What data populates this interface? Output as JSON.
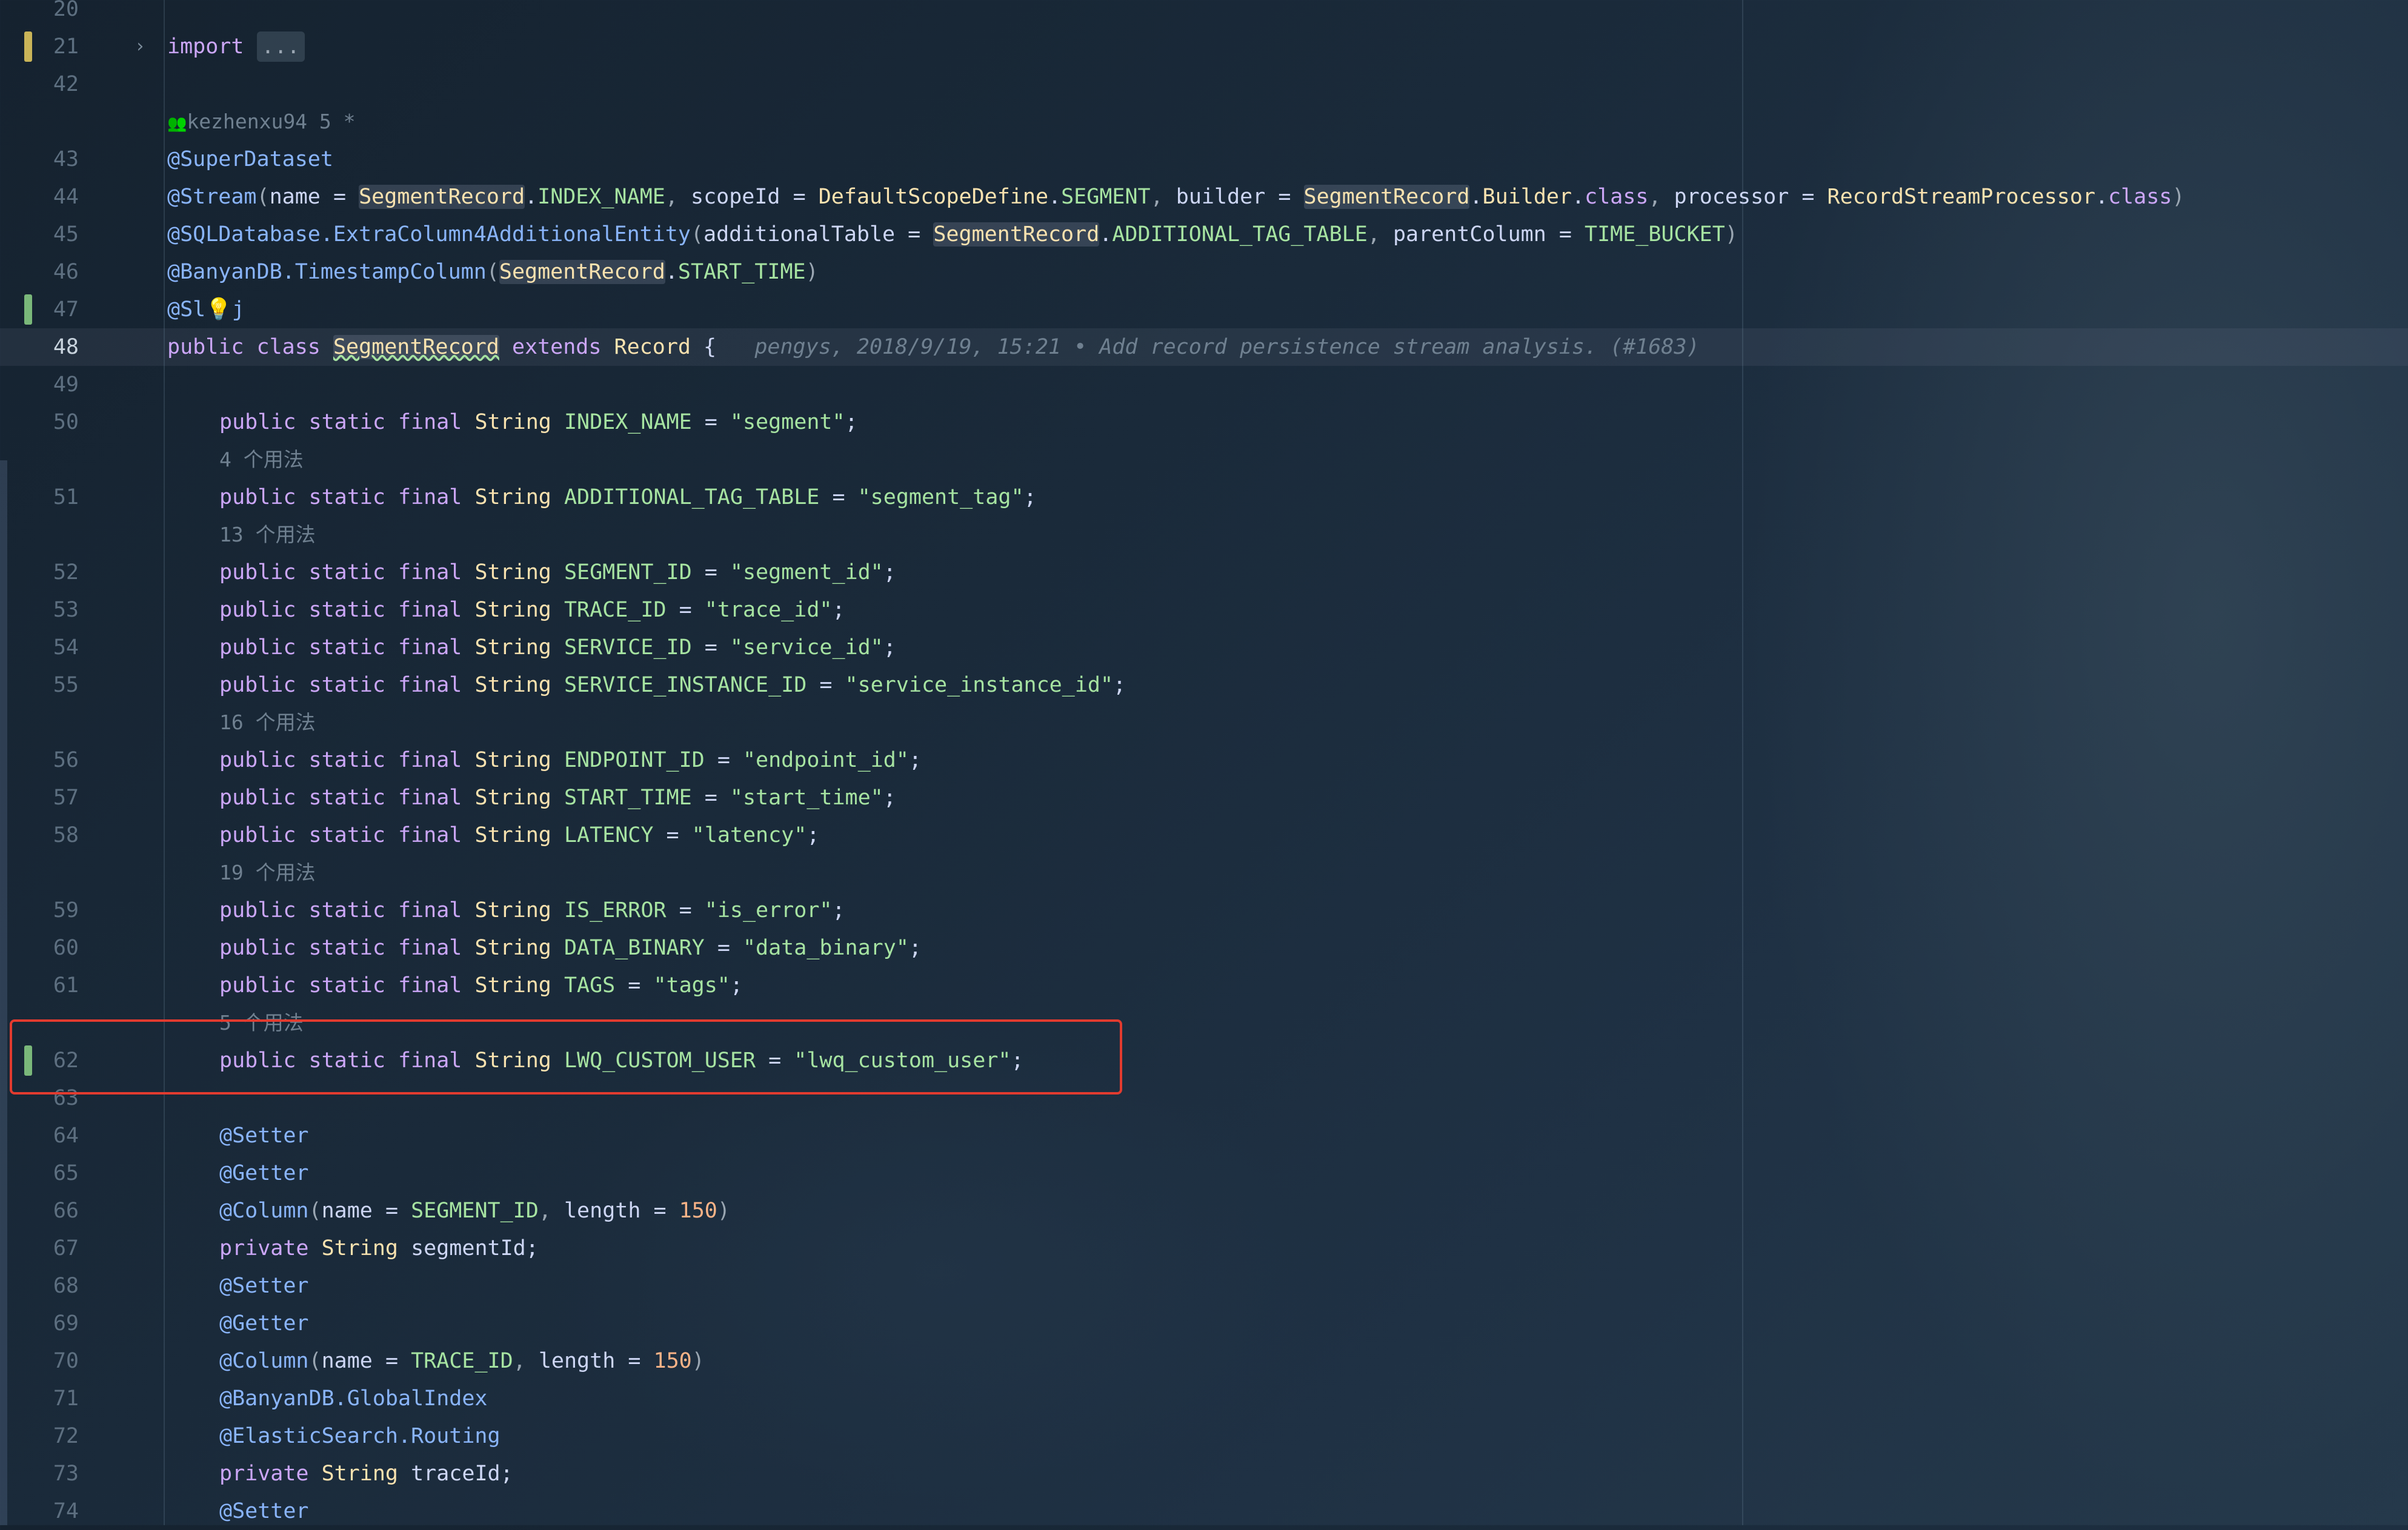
{
  "editor": {
    "lines": [
      {
        "num": "20",
        "tokens": []
      },
      {
        "num": "21",
        "marker": "yellow",
        "fold": "›",
        "tokens": [
          {
            "text": "import ",
            "cls": "k"
          },
          {
            "text": "...",
            "cls": "fold-pill"
          }
        ]
      },
      {
        "num": "42",
        "tokens": []
      },
      {
        "num": "",
        "hint": "kezhenxu94 5 *",
        "hintIcon": "👥",
        "hintCol": 1
      },
      {
        "num": "43",
        "tokens": [
          {
            "text": "@SuperDataset",
            "cls": "a"
          }
        ]
      },
      {
        "num": "44",
        "tokens": [
          {
            "text": "@Stream",
            "cls": "a"
          },
          {
            "text": "(",
            "cls": "pu"
          },
          {
            "text": "name",
            "cls": "id"
          },
          {
            "text": " = ",
            "cls": "id"
          },
          {
            "text": "SegmentRecord",
            "cls": "t hl"
          },
          {
            "text": ".",
            "cls": "id"
          },
          {
            "text": "INDEX_NAME",
            "cls": "fld"
          },
          {
            "text": ", ",
            "cls": "pu"
          },
          {
            "text": "scopeId",
            "cls": "id"
          },
          {
            "text": " = ",
            "cls": "id"
          },
          {
            "text": "DefaultScopeDefine",
            "cls": "t"
          },
          {
            "text": ".",
            "cls": "id"
          },
          {
            "text": "SEGMENT",
            "cls": "fld"
          },
          {
            "text": ", ",
            "cls": "pu"
          },
          {
            "text": "builder",
            "cls": "id"
          },
          {
            "text": " = ",
            "cls": "id"
          },
          {
            "text": "SegmentRecord",
            "cls": "t hl"
          },
          {
            "text": ".",
            "cls": "id"
          },
          {
            "text": "Builder",
            "cls": "t"
          },
          {
            "text": ".",
            "cls": "id"
          },
          {
            "text": "class",
            "cls": "k"
          },
          {
            "text": ", ",
            "cls": "pu"
          },
          {
            "text": "processor",
            "cls": "id"
          },
          {
            "text": " = ",
            "cls": "id"
          },
          {
            "text": "RecordStreamProcessor",
            "cls": "t"
          },
          {
            "text": ".",
            "cls": "id"
          },
          {
            "text": "class",
            "cls": "k"
          },
          {
            "text": ")",
            "cls": "pu"
          }
        ]
      },
      {
        "num": "45",
        "tokens": [
          {
            "text": "@SQLDatabase.ExtraColumn4AdditionalEntity",
            "cls": "a"
          },
          {
            "text": "(",
            "cls": "pu"
          },
          {
            "text": "additionalTable",
            "cls": "id"
          },
          {
            "text": " = ",
            "cls": "id"
          },
          {
            "text": "SegmentRecord",
            "cls": "t hl"
          },
          {
            "text": ".",
            "cls": "id"
          },
          {
            "text": "ADDITIONAL_TAG_TABLE",
            "cls": "fld"
          },
          {
            "text": ", ",
            "cls": "pu"
          },
          {
            "text": "parentColumn",
            "cls": "id"
          },
          {
            "text": " = ",
            "cls": "id"
          },
          {
            "text": "TIME_BUCKET",
            "cls": "fld"
          },
          {
            "text": ")",
            "cls": "pu"
          }
        ]
      },
      {
        "num": "46",
        "tokens": [
          {
            "text": "@BanyanDB.TimestampColumn",
            "cls": "a"
          },
          {
            "text": "(",
            "cls": "pu"
          },
          {
            "text": "SegmentRecord",
            "cls": "t hl"
          },
          {
            "text": ".",
            "cls": "id"
          },
          {
            "text": "START_TIME",
            "cls": "fld"
          },
          {
            "text": ")",
            "cls": "pu"
          }
        ]
      },
      {
        "num": "47",
        "marker": "green",
        "tokens": [
          {
            "text": "@Sl💡j",
            "cls": "a"
          }
        ]
      },
      {
        "num": "48",
        "active": true,
        "tokens": [
          {
            "text": "public class ",
            "cls": "k"
          },
          {
            "text": "SegmentRecord",
            "cls": "t hl under"
          },
          {
            "text": " extends ",
            "cls": "k"
          },
          {
            "text": "Record",
            "cls": "t"
          },
          {
            "text": " {",
            "cls": "id"
          },
          {
            "text": "   pengys, 2018/9/19, 15:21 • Add record persistence stream analysis. (#1683)",
            "cls": "blame"
          }
        ]
      },
      {
        "num": "49",
        "tokens": []
      },
      {
        "num": "50",
        "indent": 2,
        "tokens": [
          {
            "text": "public static final ",
            "cls": "k"
          },
          {
            "text": "String",
            "cls": "t"
          },
          {
            "text": " INDEX_NAME",
            "cls": "fld"
          },
          {
            "text": " = ",
            "cls": "id"
          },
          {
            "text": "\"segment\"",
            "cls": "s"
          },
          {
            "text": ";",
            "cls": "id"
          }
        ]
      },
      {
        "num": "",
        "hint": "4 个用法",
        "hintCol": 2
      },
      {
        "num": "51",
        "indent": 2,
        "tokens": [
          {
            "text": "public static final ",
            "cls": "k"
          },
          {
            "text": "String",
            "cls": "t"
          },
          {
            "text": " ADDITIONAL_TAG_TABLE",
            "cls": "fld"
          },
          {
            "text": " = ",
            "cls": "id"
          },
          {
            "text": "\"segment_tag\"",
            "cls": "s"
          },
          {
            "text": ";",
            "cls": "id"
          }
        ]
      },
      {
        "num": "",
        "hint": "13 个用法",
        "hintCol": 2
      },
      {
        "num": "52",
        "indent": 2,
        "tokens": [
          {
            "text": "public static final ",
            "cls": "k"
          },
          {
            "text": "String",
            "cls": "t"
          },
          {
            "text": " SEGMENT_ID",
            "cls": "fld"
          },
          {
            "text": " = ",
            "cls": "id"
          },
          {
            "text": "\"segment_id\"",
            "cls": "s"
          },
          {
            "text": ";",
            "cls": "id"
          }
        ]
      },
      {
        "num": "53",
        "indent": 2,
        "tokens": [
          {
            "text": "public static final ",
            "cls": "k"
          },
          {
            "text": "String",
            "cls": "t"
          },
          {
            "text": " TRACE_ID",
            "cls": "fld"
          },
          {
            "text": " = ",
            "cls": "id"
          },
          {
            "text": "\"trace_id\"",
            "cls": "s"
          },
          {
            "text": ";",
            "cls": "id"
          }
        ]
      },
      {
        "num": "54",
        "indent": 2,
        "tokens": [
          {
            "text": "public static final ",
            "cls": "k"
          },
          {
            "text": "String",
            "cls": "t"
          },
          {
            "text": " SERVICE_ID",
            "cls": "fld"
          },
          {
            "text": " = ",
            "cls": "id"
          },
          {
            "text": "\"service_id\"",
            "cls": "s"
          },
          {
            "text": ";",
            "cls": "id"
          }
        ]
      },
      {
        "num": "55",
        "indent": 2,
        "tokens": [
          {
            "text": "public static final ",
            "cls": "k"
          },
          {
            "text": "String",
            "cls": "t"
          },
          {
            "text": " SERVICE_INSTANCE_ID",
            "cls": "fld"
          },
          {
            "text": " = ",
            "cls": "id"
          },
          {
            "text": "\"service_instance_id\"",
            "cls": "s"
          },
          {
            "text": ";",
            "cls": "id"
          }
        ]
      },
      {
        "num": "",
        "hint": "16 个用法",
        "hintCol": 2
      },
      {
        "num": "56",
        "indent": 2,
        "tokens": [
          {
            "text": "public static final ",
            "cls": "k"
          },
          {
            "text": "String",
            "cls": "t"
          },
          {
            "text": " ENDPOINT_ID",
            "cls": "fld"
          },
          {
            "text": " = ",
            "cls": "id"
          },
          {
            "text": "\"endpoint_id\"",
            "cls": "s"
          },
          {
            "text": ";",
            "cls": "id"
          }
        ]
      },
      {
        "num": "57",
        "indent": 2,
        "tokens": [
          {
            "text": "public static final ",
            "cls": "k"
          },
          {
            "text": "String",
            "cls": "t"
          },
          {
            "text": " START_TIME",
            "cls": "fld"
          },
          {
            "text": " = ",
            "cls": "id"
          },
          {
            "text": "\"start_time\"",
            "cls": "s"
          },
          {
            "text": ";",
            "cls": "id"
          }
        ]
      },
      {
        "num": "58",
        "indent": 2,
        "tokens": [
          {
            "text": "public static final ",
            "cls": "k"
          },
          {
            "text": "String",
            "cls": "t"
          },
          {
            "text": " LATENCY",
            "cls": "fld"
          },
          {
            "text": " = ",
            "cls": "id"
          },
          {
            "text": "\"latency\"",
            "cls": "s"
          },
          {
            "text": ";",
            "cls": "id"
          }
        ]
      },
      {
        "num": "",
        "hint": "19 个用法",
        "hintCol": 2
      },
      {
        "num": "59",
        "indent": 2,
        "tokens": [
          {
            "text": "public static final ",
            "cls": "k"
          },
          {
            "text": "String",
            "cls": "t"
          },
          {
            "text": " IS_ERROR",
            "cls": "fld"
          },
          {
            "text": " = ",
            "cls": "id"
          },
          {
            "text": "\"is_error\"",
            "cls": "s"
          },
          {
            "text": ";",
            "cls": "id"
          }
        ]
      },
      {
        "num": "60",
        "indent": 2,
        "tokens": [
          {
            "text": "public static final ",
            "cls": "k"
          },
          {
            "text": "String",
            "cls": "t"
          },
          {
            "text": " DATA_BINARY",
            "cls": "fld"
          },
          {
            "text": " = ",
            "cls": "id"
          },
          {
            "text": "\"data_binary\"",
            "cls": "s"
          },
          {
            "text": ";",
            "cls": "id"
          }
        ]
      },
      {
        "num": "61",
        "indent": 2,
        "tokens": [
          {
            "text": "public static final ",
            "cls": "k"
          },
          {
            "text": "String",
            "cls": "t"
          },
          {
            "text": " TAGS",
            "cls": "fld"
          },
          {
            "text": " = ",
            "cls": "id"
          },
          {
            "text": "\"tags\"",
            "cls": "s"
          },
          {
            "text": ";",
            "cls": "id"
          }
        ]
      },
      {
        "num": "",
        "hint": "5 个用法",
        "hintCol": 2
      },
      {
        "num": "62",
        "marker": "green",
        "indent": 2,
        "tokens": [
          {
            "text": "public static final ",
            "cls": "k"
          },
          {
            "text": "String",
            "cls": "t"
          },
          {
            "text": " LWQ_CUSTOM_USER",
            "cls": "fld"
          },
          {
            "text": " = ",
            "cls": "id"
          },
          {
            "text": "\"lwq_custom_user\"",
            "cls": "s"
          },
          {
            "text": ";",
            "cls": "id"
          }
        ]
      },
      {
        "num": "63",
        "tokens": []
      },
      {
        "num": "64",
        "indent": 2,
        "tokens": [
          {
            "text": "@Setter",
            "cls": "a"
          }
        ]
      },
      {
        "num": "65",
        "indent": 2,
        "tokens": [
          {
            "text": "@Getter",
            "cls": "a"
          }
        ]
      },
      {
        "num": "66",
        "indent": 2,
        "tokens": [
          {
            "text": "@Column",
            "cls": "a"
          },
          {
            "text": "(",
            "cls": "pu"
          },
          {
            "text": "name",
            "cls": "id"
          },
          {
            "text": " = ",
            "cls": "id"
          },
          {
            "text": "SEGMENT_ID",
            "cls": "fld"
          },
          {
            "text": ", ",
            "cls": "pu"
          },
          {
            "text": "length",
            "cls": "id"
          },
          {
            "text": " = ",
            "cls": "id"
          },
          {
            "text": "150",
            "cls": "n"
          },
          {
            "text": ")",
            "cls": "pu"
          }
        ]
      },
      {
        "num": "67",
        "indent": 2,
        "tokens": [
          {
            "text": "private ",
            "cls": "k"
          },
          {
            "text": "String",
            "cls": "t"
          },
          {
            "text": " segmentId",
            "cls": "id"
          },
          {
            "text": ";",
            "cls": "id"
          }
        ]
      },
      {
        "num": "68",
        "indent": 2,
        "tokens": [
          {
            "text": "@Setter",
            "cls": "a"
          }
        ]
      },
      {
        "num": "69",
        "indent": 2,
        "tokens": [
          {
            "text": "@Getter",
            "cls": "a"
          }
        ]
      },
      {
        "num": "70",
        "indent": 2,
        "tokens": [
          {
            "text": "@Column",
            "cls": "a"
          },
          {
            "text": "(",
            "cls": "pu"
          },
          {
            "text": "name",
            "cls": "id"
          },
          {
            "text": " = ",
            "cls": "id"
          },
          {
            "text": "TRACE_ID",
            "cls": "fld"
          },
          {
            "text": ", ",
            "cls": "pu"
          },
          {
            "text": "length",
            "cls": "id"
          },
          {
            "text": " = ",
            "cls": "id"
          },
          {
            "text": "150",
            "cls": "n"
          },
          {
            "text": ")",
            "cls": "pu"
          }
        ]
      },
      {
        "num": "71",
        "indent": 2,
        "tokens": [
          {
            "text": "@BanyanDB.GlobalIndex",
            "cls": "a"
          }
        ]
      },
      {
        "num": "72",
        "indent": 2,
        "tokens": [
          {
            "text": "@ElasticSearch.Routing",
            "cls": "a"
          }
        ]
      },
      {
        "num": "73",
        "indent": 2,
        "tokens": [
          {
            "text": "private ",
            "cls": "k"
          },
          {
            "text": "String",
            "cls": "t"
          },
          {
            "text": " traceId",
            "cls": "id"
          },
          {
            "text": ";",
            "cls": "id"
          }
        ]
      },
      {
        "num": "74",
        "indent": 2,
        "tokens": [
          {
            "text": "@Setter",
            "cls": "a"
          }
        ]
      }
    ]
  },
  "colors": {
    "highlight_box": "#e23b2f",
    "marker_yellow": "#c9b458",
    "marker_green": "#7ab87a"
  }
}
